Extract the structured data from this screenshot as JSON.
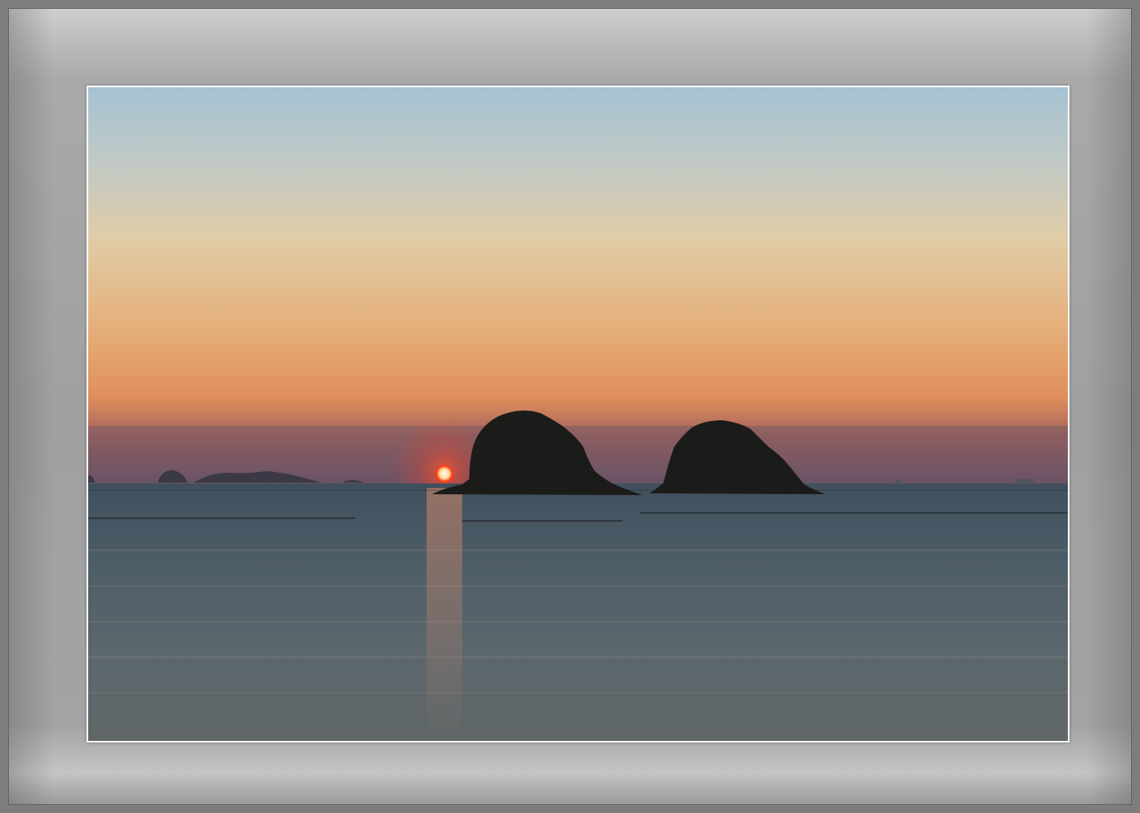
{
  "scene": {
    "subject": "sunset-over-sea-with-two-islands",
    "colors": {
      "sky_top": "#a9c4d3",
      "sky_mid": "#e2c9a2",
      "sky_low": "#e49a5c",
      "horizon_band": "#7c5a66",
      "sun": "#ff2a10",
      "sun_core": "#fff4d8",
      "sea": "#4b5a66",
      "island": "#1c1c1a",
      "mat_light": "#cfcfcf",
      "mat_dark": "#9a9a9a"
    }
  }
}
